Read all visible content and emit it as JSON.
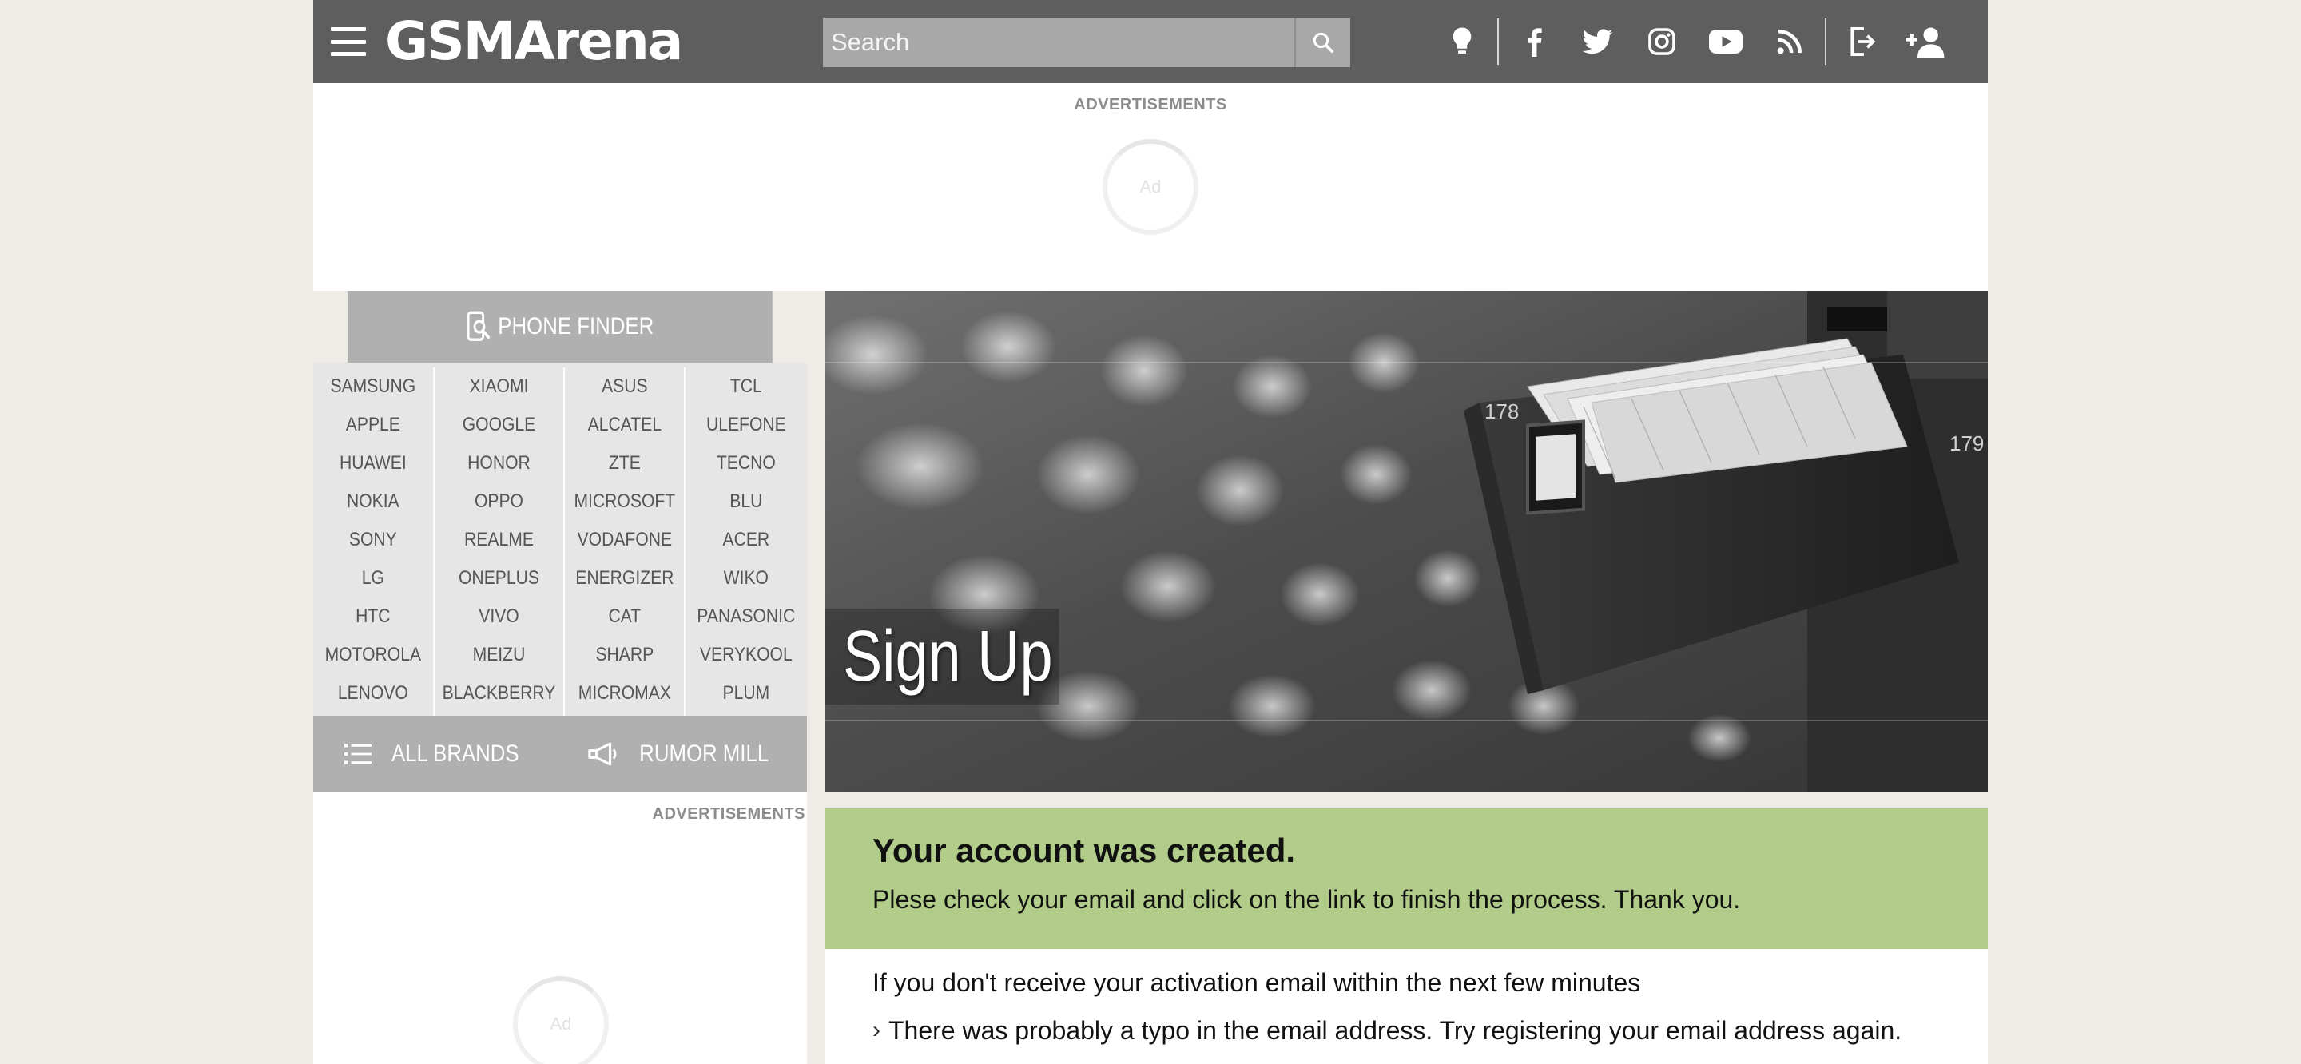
{
  "header": {
    "logo_text": "GSMArena",
    "search": {
      "placeholder": "Search"
    },
    "icons": [
      "lightbulb-icon",
      "facebook-icon",
      "twitter-icon",
      "instagram-icon",
      "youtube-icon",
      "rss-icon",
      "login-icon",
      "add-user-icon"
    ]
  },
  "ads": {
    "top_label": "ADVERTISEMENTS",
    "top_spinner_text": "Ad",
    "left_label": "ADVERTISEMENTS",
    "left_spinner_text": "Ad"
  },
  "phone_finder": {
    "title": "PHONE FINDER",
    "columns": [
      [
        "SAMSUNG",
        "APPLE",
        "HUAWEI",
        "NOKIA",
        "SONY",
        "LG",
        "HTC",
        "MOTOROLA",
        "LENOVO"
      ],
      [
        "XIAOMI",
        "GOOGLE",
        "HONOR",
        "OPPO",
        "REALME",
        "ONEPLUS",
        "VIVO",
        "MEIZU",
        "BLACKBERRY"
      ],
      [
        "ASUS",
        "ALCATEL",
        "ZTE",
        "MICROSOFT",
        "VODAFONE",
        "ENERGIZER",
        "CAT",
        "SHARP",
        "MICROMAX"
      ],
      [
        "TCL",
        "ULEFONE",
        "TECNO",
        "BLU",
        "ACER",
        "WIKO",
        "PANASONIC",
        "VERYKOOL",
        "PLUM"
      ]
    ],
    "all_brands": "ALL BRANDS",
    "rumor_mill": "RUMOR MILL"
  },
  "hero": {
    "title": "Sign Up",
    "drawer_label_left": "178",
    "drawer_label_right": "179"
  },
  "success": {
    "heading": "Your account was created.",
    "message": "Plese check your email and click on the link to finish the process. Thank you."
  },
  "info": {
    "intro": "If you don't receive your activation email within the next few minutes",
    "bullets": [
      "There was probably a typo in the email address. Try registering your email address again."
    ]
  },
  "colors": {
    "header_bg": "#5e5e5e",
    "page_bg": "#efebe7",
    "finder_bar": "#b0b0b0",
    "finder_grid": "#e6e6e6",
    "success_bg": "#b2cd8a"
  }
}
